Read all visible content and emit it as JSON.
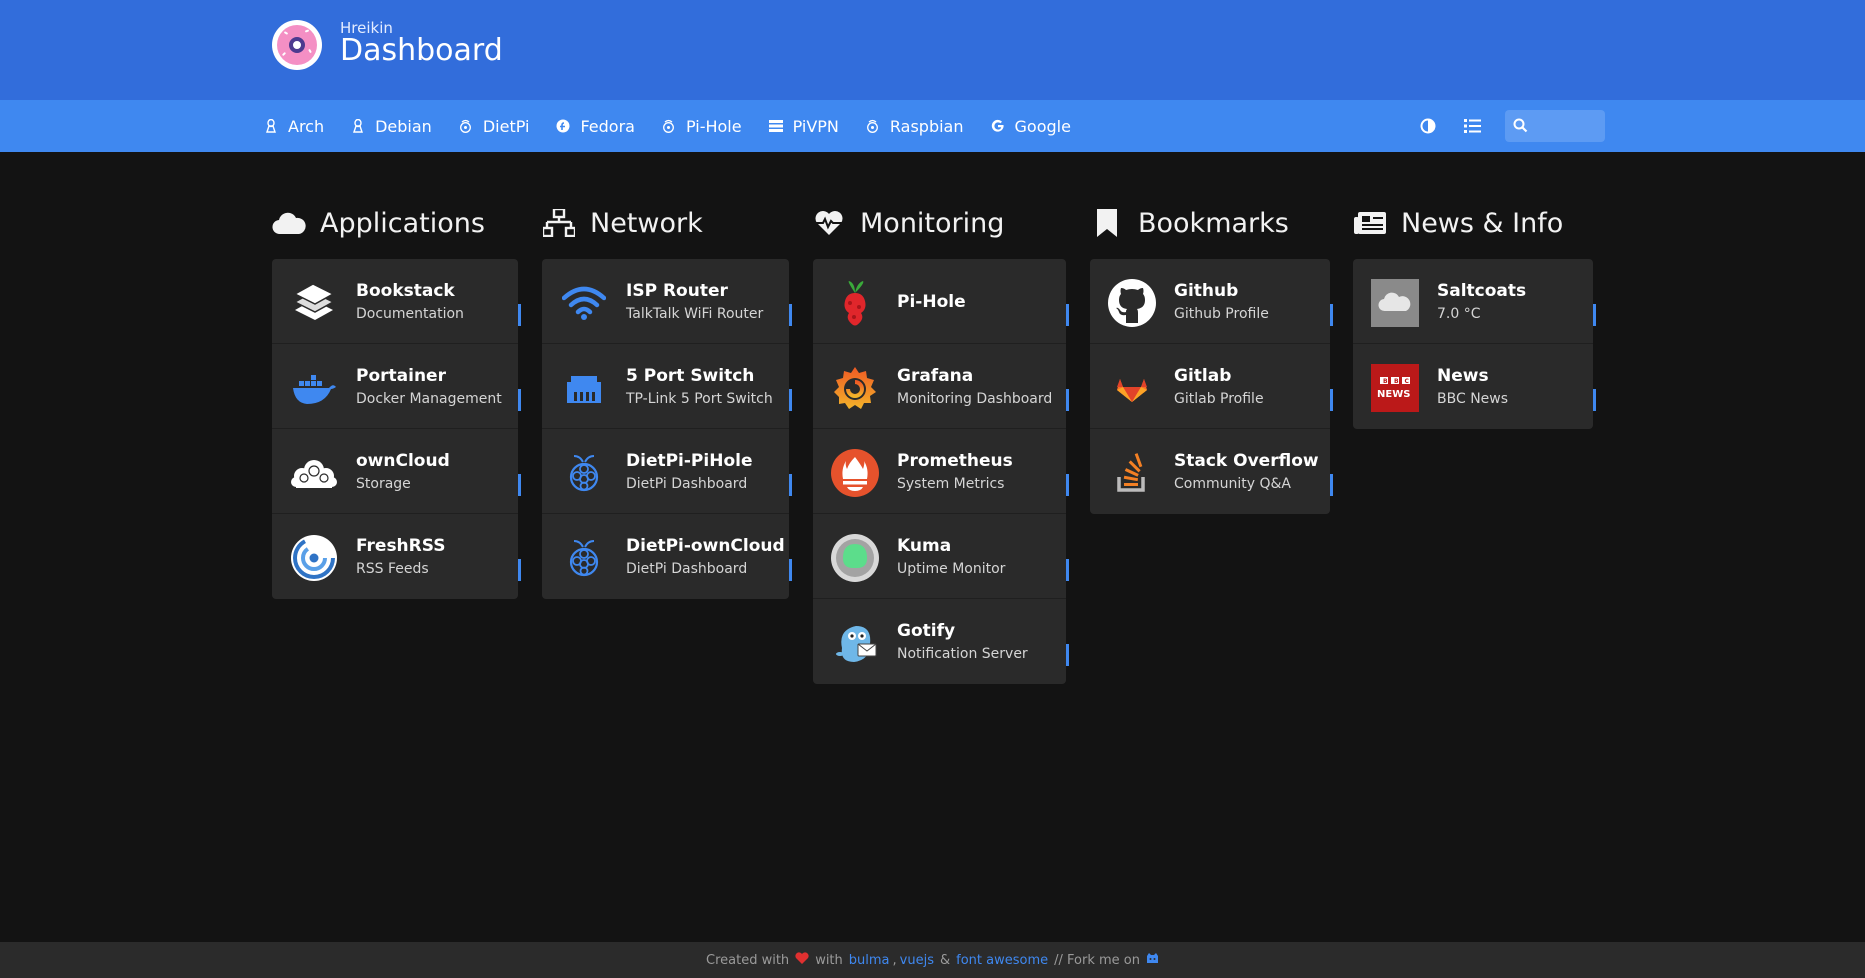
{
  "header": {
    "subtitle": "Hreikin",
    "title": "Dashboard"
  },
  "nav": {
    "links": [
      {
        "label": "Arch",
        "icon": "linux-icon"
      },
      {
        "label": "Debian",
        "icon": "linux-icon"
      },
      {
        "label": "DietPi",
        "icon": "raspberry-pi-icon"
      },
      {
        "label": "Fedora",
        "icon": "fedora-icon"
      },
      {
        "label": "Pi-Hole",
        "icon": "raspberry-pi-icon"
      },
      {
        "label": "PiVPN",
        "icon": "server-icon"
      },
      {
        "label": "Raspbian",
        "icon": "raspberry-pi-icon"
      },
      {
        "label": "Google",
        "icon": "google-icon"
      }
    ],
    "tools": [
      "theme-toggle-icon",
      "layout-list-icon"
    ],
    "search": {
      "placeholder": ""
    }
  },
  "columns": [
    {
      "title": "Applications",
      "icon": "cloud-icon",
      "items": [
        {
          "name": "Bookstack",
          "subtitle": "Documentation",
          "icon": "bookstack-icon"
        },
        {
          "name": "Portainer",
          "subtitle": "Docker Management",
          "icon": "docker-icon"
        },
        {
          "name": "ownCloud",
          "subtitle": "Storage",
          "icon": "owncloud-icon"
        },
        {
          "name": "FreshRSS",
          "subtitle": "RSS Feeds",
          "icon": "freshrss-icon"
        }
      ]
    },
    {
      "title": "Network",
      "icon": "network-icon",
      "items": [
        {
          "name": "ISP Router",
          "subtitle": "TalkTalk WiFi Router",
          "icon": "wifi-icon"
        },
        {
          "name": "5 Port Switch",
          "subtitle": "TP-Link 5 Port Switch",
          "icon": "ethernet-icon"
        },
        {
          "name": "DietPi-PiHole",
          "subtitle": "DietPi Dashboard",
          "icon": "raspberry-pi-icon"
        },
        {
          "name": "DietPi-ownCloud",
          "subtitle": "DietPi Dashboard",
          "icon": "raspberry-pi-icon"
        }
      ]
    },
    {
      "title": "Monitoring",
      "icon": "heartbeat-icon",
      "items": [
        {
          "name": "Pi-Hole",
          "subtitle": "",
          "icon": "pihole-icon"
        },
        {
          "name": "Grafana",
          "subtitle": "Monitoring Dashboard",
          "icon": "grafana-icon"
        },
        {
          "name": "Prometheus",
          "subtitle": "System Metrics",
          "icon": "prometheus-icon"
        },
        {
          "name": "Kuma",
          "subtitle": "Uptime Monitor",
          "icon": "kuma-icon"
        },
        {
          "name": "Gotify",
          "subtitle": "Notification Server",
          "icon": "gotify-icon"
        }
      ]
    },
    {
      "title": "Bookmarks",
      "icon": "bookmark-icon",
      "items": [
        {
          "name": "Github",
          "subtitle": "Github Profile",
          "icon": "github-icon"
        },
        {
          "name": "Gitlab",
          "subtitle": "Gitlab Profile",
          "icon": "gitlab-icon"
        },
        {
          "name": "Stack Overflow",
          "subtitle": "Community Q&A",
          "icon": "stackoverflow-icon"
        }
      ]
    },
    {
      "title": "News & Info",
      "icon": "newspaper-icon",
      "items": [
        {
          "name": "Saltcoats",
          "subtitle": "7.0 °C",
          "icon": "weather-cloud-icon"
        },
        {
          "name": "News",
          "subtitle": "BBC News",
          "icon": "bbc-news-icon"
        }
      ]
    }
  ],
  "footer": {
    "prefix": "Created with",
    "with": "with",
    "link1": "bulma",
    "link2": "vuejs",
    "amp": "&",
    "link3": "font awesome",
    "fork": "// Fork me on"
  },
  "colors": {
    "header": "#326ddb",
    "navbar": "#3f88f0",
    "background": "#131313",
    "card": "#2a2a2a",
    "accent": "#3f88f0"
  }
}
